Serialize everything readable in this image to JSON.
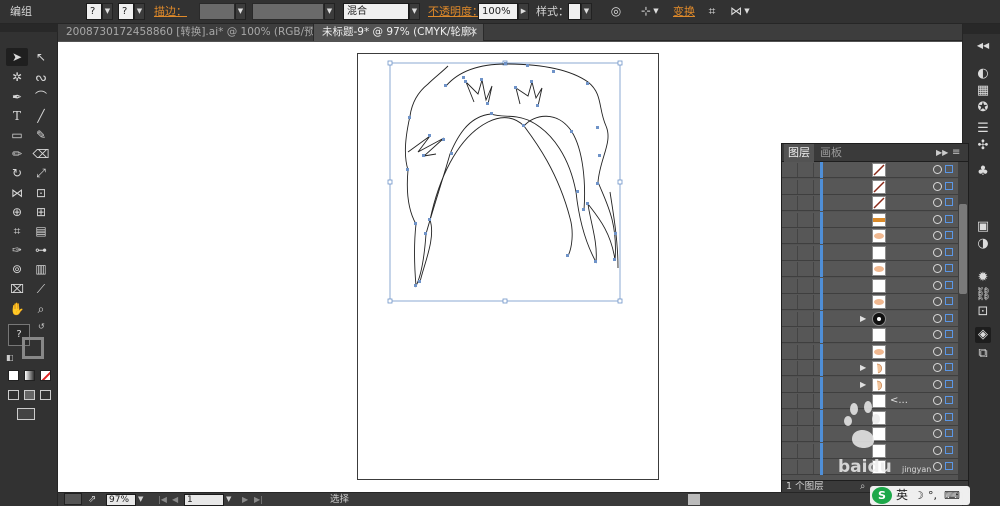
{
  "control_bar": {
    "mode_label": "编组",
    "q1": "?",
    "q2": "?",
    "stroke_label": "描边：",
    "blend_mode": "混合",
    "opacity_label": "不透明度：",
    "opacity_value": "100%",
    "style_label": "样式：",
    "transform_label": "变换"
  },
  "tabs": [
    {
      "label": "2008730172458860 [转换].ai* @ 100% (RGB/预览)",
      "active": false
    },
    {
      "label": "未标题-9* @ 97% (CMYK/轮廓)",
      "active": true
    }
  ],
  "tools": {
    "active": "selection",
    "swatch_question": "?"
  },
  "layers_panel": {
    "tab_layers": "图层",
    "tab_artboards": "画板",
    "layer_count": "1 个图层",
    "ellipsis": "<...",
    "rows": [
      {
        "thumb": "diagonal-line",
        "expandable": false
      },
      {
        "thumb": "diagonal-line",
        "expandable": false
      },
      {
        "thumb": "diagonal-line",
        "expandable": false
      },
      {
        "thumb": "orange-stripe",
        "expandable": false
      },
      {
        "thumb": "skin-shape",
        "expandable": false
      },
      {
        "thumb": "blank",
        "expandable": false
      },
      {
        "thumb": "skin-shape",
        "expandable": false
      },
      {
        "thumb": "blank",
        "expandable": false
      },
      {
        "thumb": "skin-shape",
        "expandable": false
      },
      {
        "thumb": "eye-black",
        "expandable": true
      },
      {
        "thumb": "blank",
        "expandable": false
      },
      {
        "thumb": "skin-shape",
        "expandable": false
      },
      {
        "thumb": "ear",
        "expandable": true
      },
      {
        "thumb": "ear",
        "expandable": true
      },
      {
        "thumb": "group",
        "expandable": false
      },
      {
        "thumb": "blank",
        "expandable": false
      },
      {
        "thumb": "blank",
        "expandable": false
      },
      {
        "thumb": "blank",
        "expandable": false
      },
      {
        "thumb": "blank",
        "expandable": false
      }
    ]
  },
  "status_bar": {
    "zoom": "97%",
    "page": "1",
    "tool_status": "选择"
  },
  "watermark": {
    "brand": "baidu",
    "sub": "jingyan"
  },
  "ime": {
    "lang": "英"
  },
  "colors": {
    "accent_orange": "#e08a2a",
    "layer_blue": "#4f8fd8",
    "ui_dark": "#323232",
    "ui_mid": "#535353"
  }
}
